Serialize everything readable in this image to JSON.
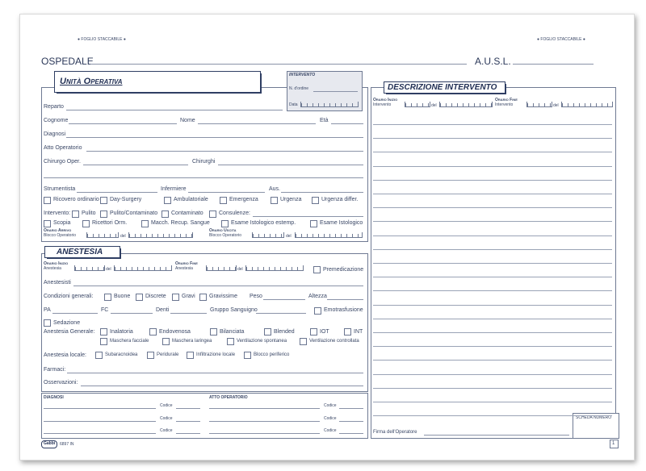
{
  "top_tags": {
    "left": "● FOGLIO STACCABILE ●",
    "right": "● FOGLIO STACCABILE ●"
  },
  "header": {
    "ospedale": "OSPEDALE",
    "ausl": "A.U.S.L."
  },
  "unita": {
    "title": "Unità Operativa",
    "intervento": {
      "title": "INTERVENTO",
      "n_ordine": "N. d'ordine",
      "data": "Data"
    },
    "reparto": "Reparto",
    "cognome": "Cognome",
    "nome": "Nome",
    "eta": "Età",
    "diagnosi": "Diagnosi",
    "atto_operatorio": "Atto Operatorio",
    "chirurgo_oper": "Chirurgo Oper.",
    "chirurghi": "Chirurghi",
    "strumentista": "Strumentista",
    "infermiere": "Infermiere",
    "aus": "Aus.",
    "ricovero": [
      "Ricovero ordinario",
      "Day-Surgery",
      "Ambulatoriale",
      "Emergenza",
      "Urgenza",
      "Urgenza differ."
    ],
    "intervento_label": "Intervento:",
    "intervento_opts": [
      "Pulito",
      "Pulito/Contaminato",
      "Contaminato",
      "Consulenze:"
    ],
    "esami": [
      "Scopia",
      "Ricettori Orm.",
      "Macch. Recup. Sangue",
      "Esame Istologico estemp.",
      "Esame Istologico"
    ],
    "orario_arrivo": "Orario Arrivo",
    "blocco_operatorio": "Blocco Operatorio",
    "orario_uscita": "Orario Uscita",
    "del": "del"
  },
  "anestesia": {
    "title": "ANESTESIA",
    "orario_inizio": "Orario Inizio",
    "orario_fine": "Orario Fine",
    "anestesia": "Anestesia",
    "del": "del",
    "premedicazione": "Premedicazione",
    "anestesisti": "Anestesisti",
    "condizioni_label": "Condizioni generali:",
    "condizioni": [
      "Buone",
      "Discrete",
      "Gravi",
      "Gravissime"
    ],
    "peso": "Peso",
    "altezza": "Altezza",
    "pa": "PA",
    "fc": "FC",
    "denti": "Denti",
    "gruppo": "Gruppo Sanguigno",
    "emotrasfusione": "Emotrasfusione",
    "sedazione": "Sedazione",
    "generale_label": "Anestesia Generale:",
    "generale_row1": [
      "Inalatoria",
      "Endovenosa",
      "Bilanciata",
      "Blended",
      "IOT",
      "INT"
    ],
    "generale_row2": [
      "Maschera facciale",
      "Maschera laringea",
      "Ventilazione spontanea",
      "Ventilazione controllata"
    ],
    "locale_label": "Anestesia locale:",
    "locale": [
      "Subaracnoidea",
      "Peridurale",
      "Infiltrazione locale",
      "Blocco periferico"
    ],
    "farmaci": "Farmaci:",
    "osservazioni": "Osservazioni:"
  },
  "bottom": {
    "diagnosi": "DIAGNOSI",
    "atto_operatorio": "ATTO OPERATORIO",
    "codice": "Codice"
  },
  "descrizione": {
    "title": "DESCRIZIONE INTERVENTO",
    "orario_inizio": "Orario Inizio",
    "orario_fine": "Orario Fine",
    "intervento": "Intervento",
    "del": "del",
    "firma": "Firma dell'Operatore",
    "scheda": "SCHEDA NUMERO"
  },
  "footer": {
    "brand": "Gabbi",
    "code": "6897 IN",
    "page": "1"
  }
}
